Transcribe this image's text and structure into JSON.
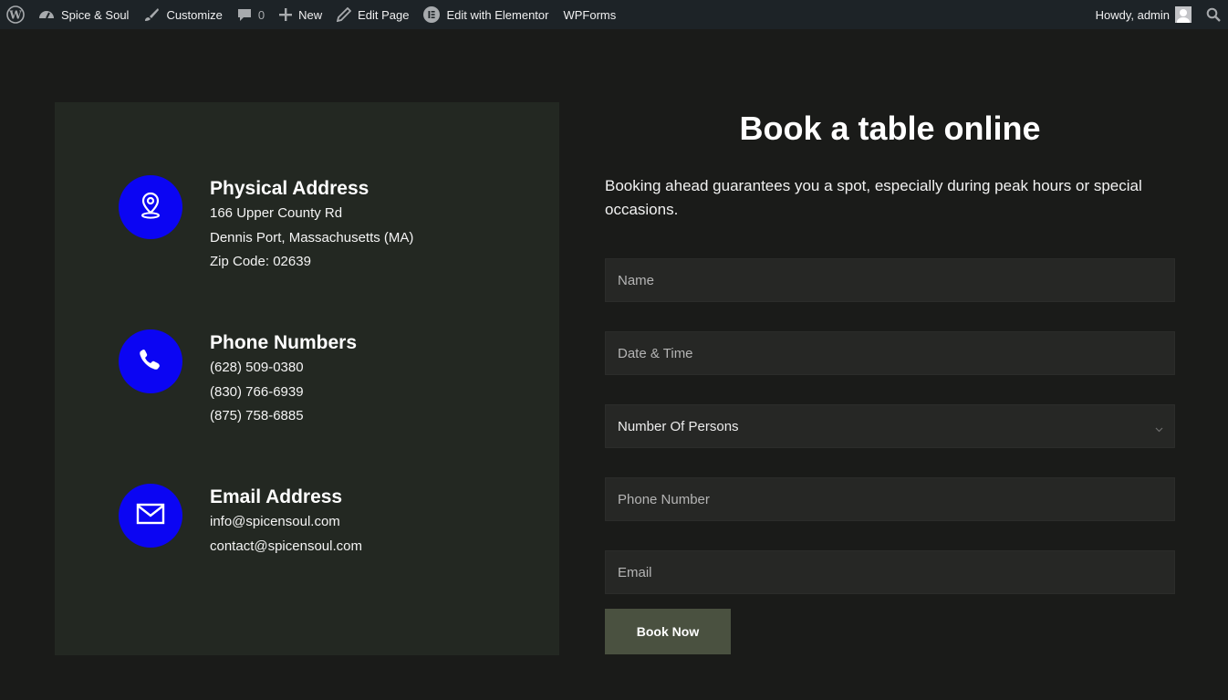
{
  "admin_bar": {
    "site_name": "Spice & Soul",
    "customize": "Customize",
    "comments_count": "0",
    "new": "New",
    "edit_page": "Edit Page",
    "edit_elementor": "Edit with Elementor",
    "wpforms": "WPForms",
    "howdy": "Howdy, admin"
  },
  "contact": {
    "address": {
      "title": "Physical Address",
      "lines": [
        "166 Upper County Rd",
        "Dennis Port, Massachusetts (MA)",
        "Zip Code: 02639"
      ]
    },
    "phone": {
      "title": "Phone Numbers",
      "lines": [
        "(628) 509-0380",
        "(830) 766-6939",
        "(875) 758-6885"
      ]
    },
    "email": {
      "title": "Email Address",
      "lines": [
        "info@spicensoul.com",
        "contact@spicensoul.com"
      ]
    }
  },
  "booking": {
    "title": "Book a table online",
    "lead": "Booking ahead guarantees you a spot, especially during peak hours or special occasions.",
    "fields": {
      "name_placeholder": "Name",
      "datetime_placeholder": "Date & Time",
      "persons_selected": "Number Of Persons",
      "phone_placeholder": "Phone Number",
      "email_placeholder": "Email"
    },
    "submit": "Book Now"
  },
  "colors": {
    "accent_circle": "#0b05f3",
    "panel_bg": "#232822",
    "button_bg": "#4a5140",
    "page_bg": "#1a1b19"
  }
}
